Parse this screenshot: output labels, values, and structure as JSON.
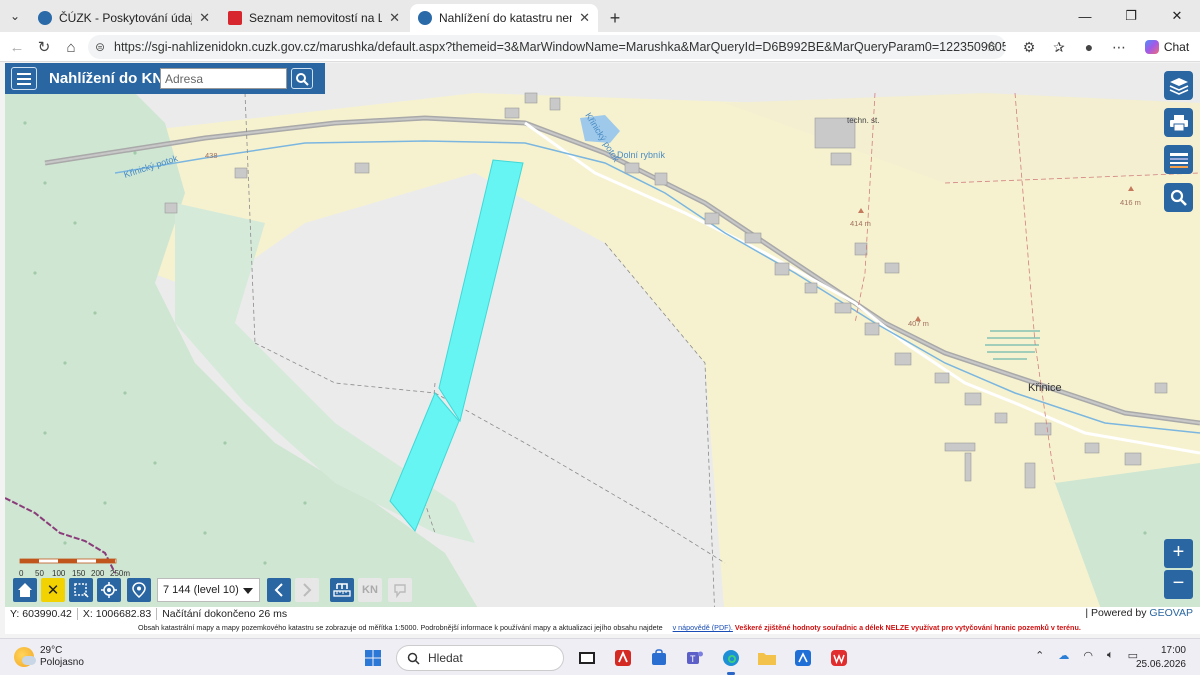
{
  "browser": {
    "tabs": [
      {
        "title": "ČÚZK - Poskytování údajů z KN",
        "icon": "cuzk-favicon",
        "active": false
      },
      {
        "title": "Seznam nemovitostí na LV | Nahlíž",
        "icon": "czech-lion-favicon",
        "active": false
      },
      {
        "title": "Nahlížení do katastru nemovitostí",
        "icon": "cuzk-favicon",
        "active": true
      }
    ],
    "url": "https://sgi-nahlizenidokn.cuzk.gov.cz/marushka/default.aspx?themeid=3&MarWindowName=Marushka&MarQueryId=D6B992BE&MarQueryParam0=1223509605&MarQueryParamCou...",
    "chat_label": "Chat"
  },
  "app": {
    "title": "Nahlížení do KN",
    "address_placeholder": "Adresa",
    "level_select": "7 144 (level 10)",
    "kn_label": "KN",
    "scale_labels": [
      "0",
      "50",
      "100",
      "150",
      "200",
      "250m"
    ]
  },
  "map": {
    "labels": {
      "stream1": "Křinický potok",
      "stream2": "Křinický potok",
      "pond": "Dolní rybník",
      "techn": "techn. st.",
      "elev_414": "414 m",
      "elev_416": "416 m",
      "elev_407": "407 m",
      "elev_438": "438",
      "village": "Křinice"
    },
    "colors": {
      "highlight_parcel": "#66f5f3",
      "forest": "#cfe6d2",
      "field": "#f6f2cf"
    }
  },
  "status": {
    "y_coord": "Y: 603990.42",
    "x_coord": "X: 1006682.83",
    "message": "Načítání dokončeno 26 ms",
    "powered_prefix": "Powered by",
    "powered_brand": "GEOVAP"
  },
  "disclaimer": {
    "text": "Obsah katastrální mapy a mapy pozemkového katastru se zobrazuje od měřítka 1:5000. Podrobnější informace k používání mapy a aktualizaci jejího obsahu najdete",
    "link": "v nápovědě (PDF).",
    "warning": "Veškeré zjištěné hodnoty souřadnic a délek NELZE využívat pro vytyčování hranic pozemků v terénu."
  },
  "taskbar": {
    "temperature": "29°C",
    "weather": "Polojasno",
    "search_placeholder": "Hledat",
    "time": "17:00",
    "date": "25.06.2026"
  }
}
